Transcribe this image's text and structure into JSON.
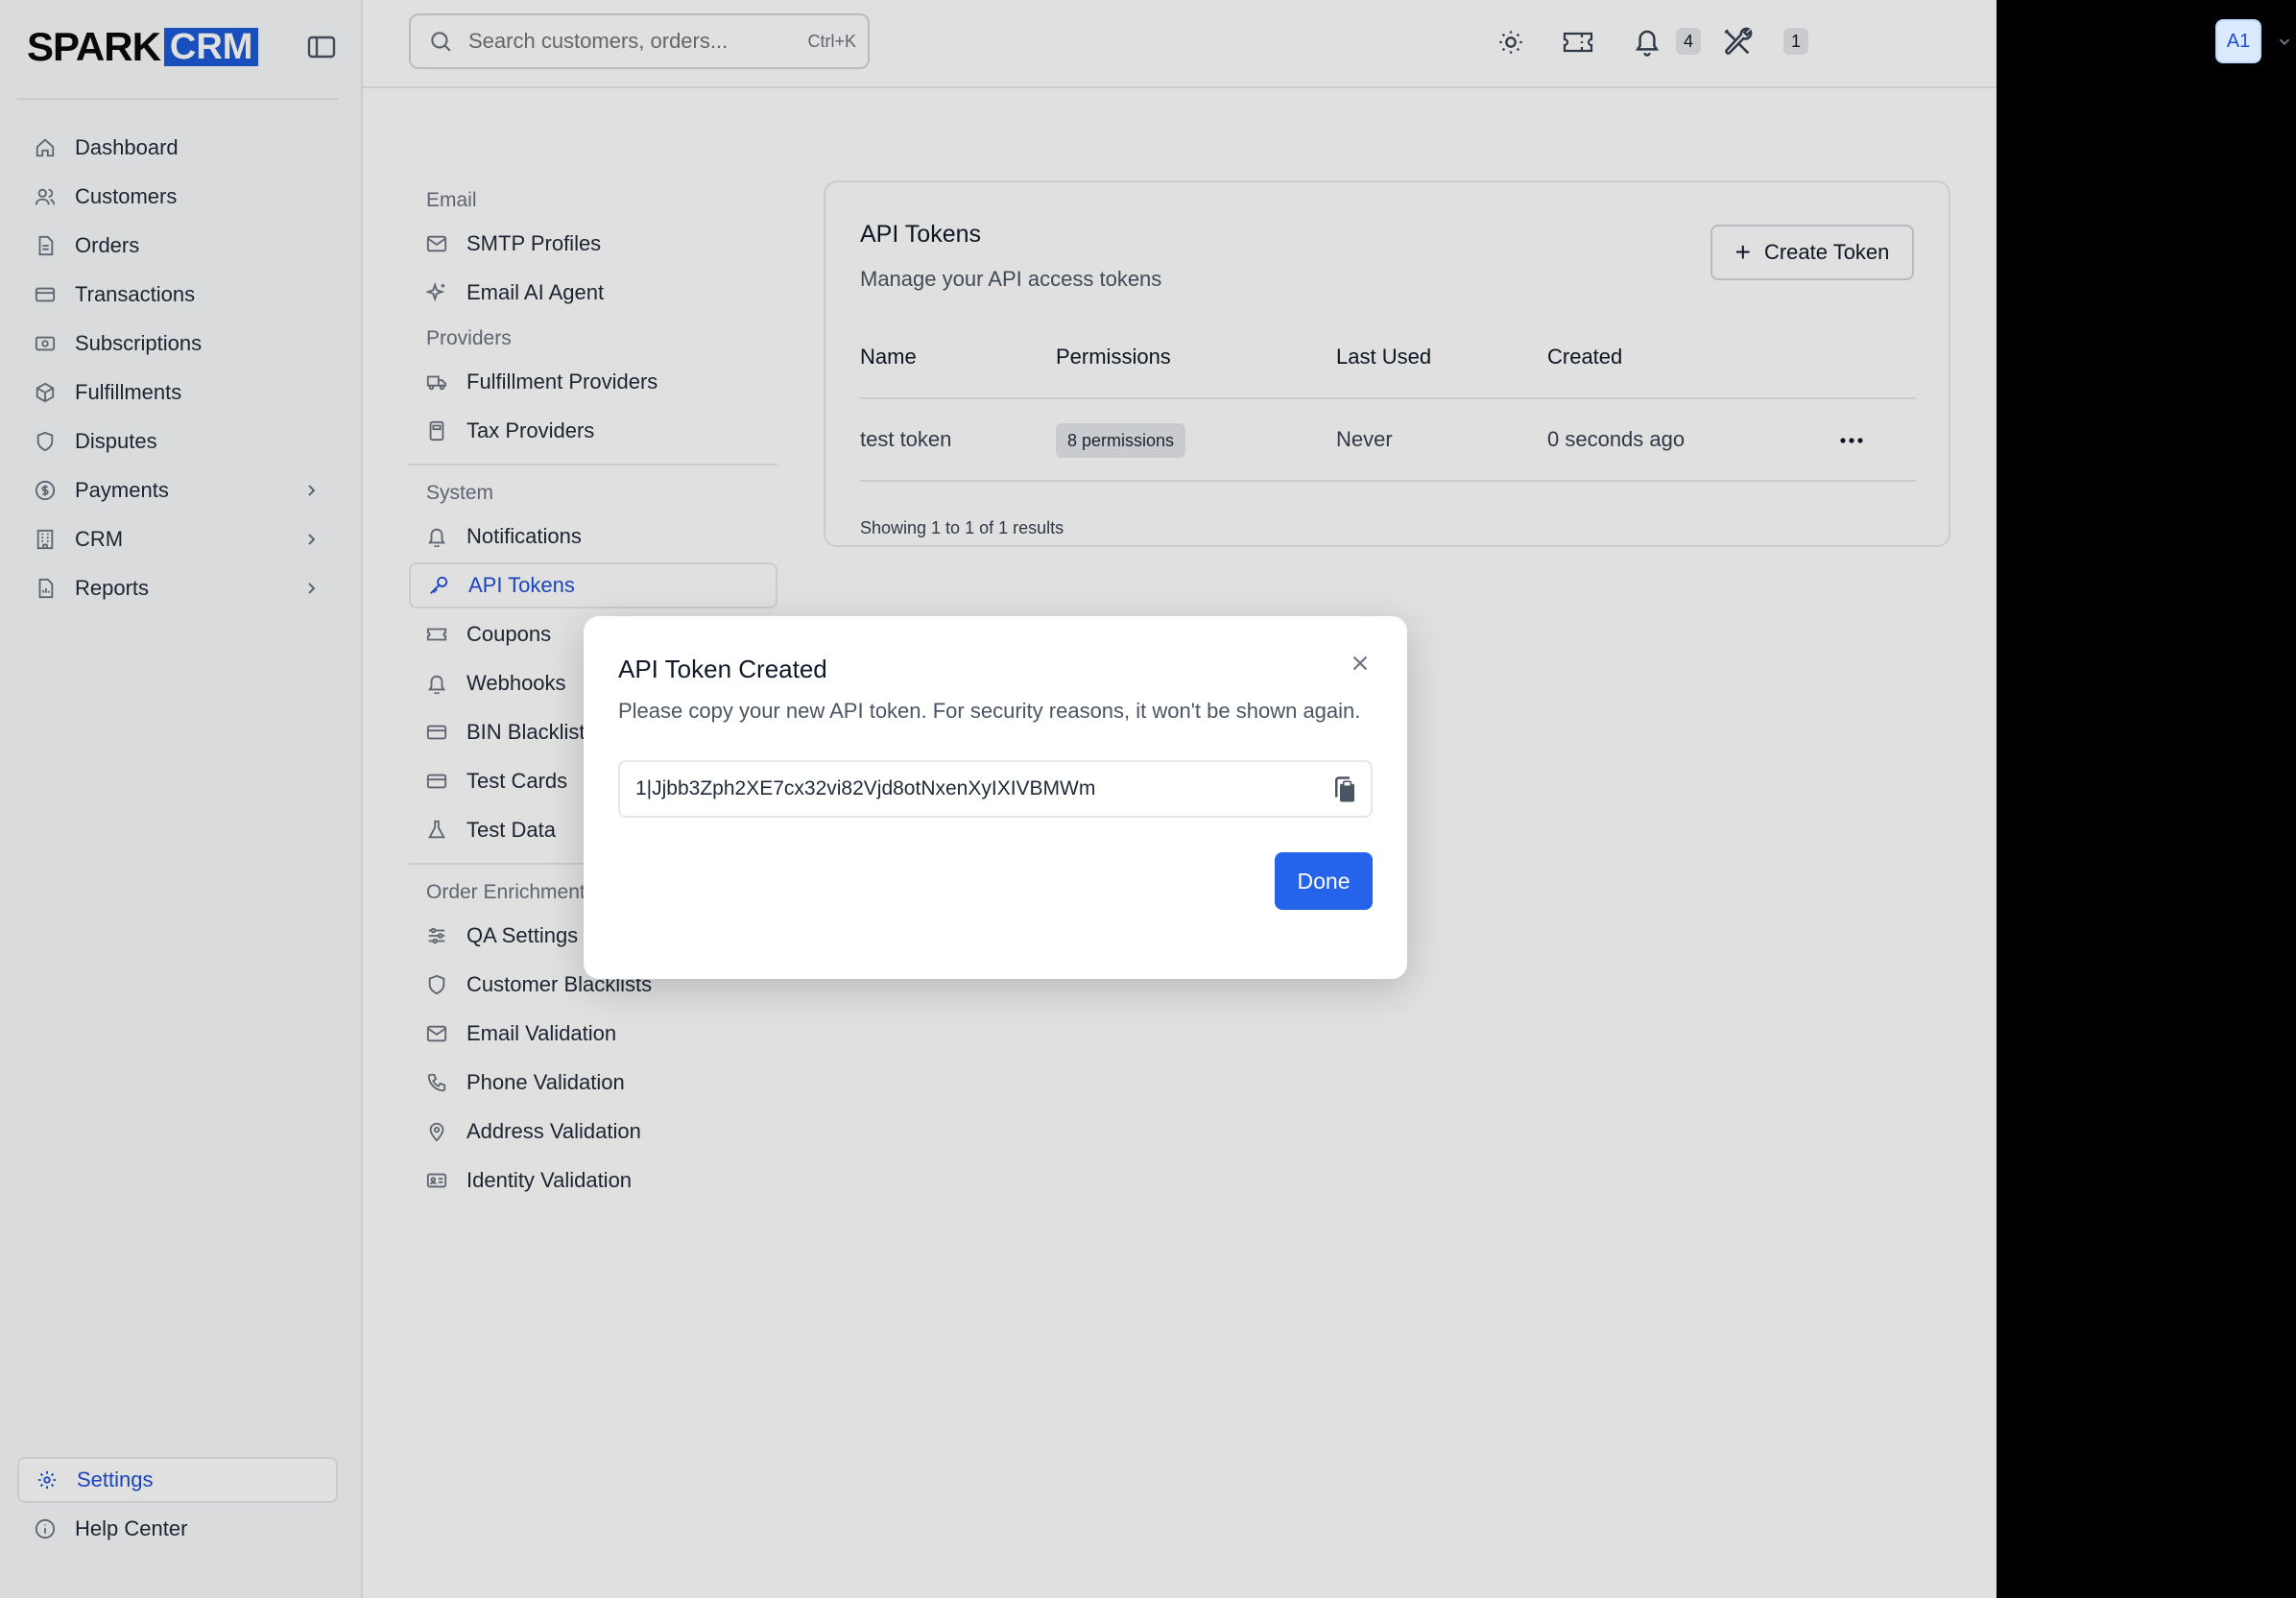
{
  "brand": {
    "part1": "SPARK",
    "part2": "CRM",
    "accent": "#1d5bd8"
  },
  "sidebar": {
    "items": [
      {
        "label": "Dashboard",
        "icon": "home-icon"
      },
      {
        "label": "Customers",
        "icon": "users-icon"
      },
      {
        "label": "Orders",
        "icon": "document-icon"
      },
      {
        "label": "Transactions",
        "icon": "credit-card-icon"
      },
      {
        "label": "Subscriptions",
        "icon": "cash-icon"
      },
      {
        "label": "Fulfillments",
        "icon": "package-icon"
      },
      {
        "label": "Disputes",
        "icon": "shield-icon"
      },
      {
        "label": "Payments",
        "icon": "dollar-circle-icon",
        "expandable": true
      },
      {
        "label": "CRM",
        "icon": "building-icon",
        "expandable": true
      },
      {
        "label": "Reports",
        "icon": "report-icon",
        "expandable": true
      }
    ],
    "bottom": [
      {
        "label": "Settings",
        "icon": "gear-icon",
        "active": true
      },
      {
        "label": "Help Center",
        "icon": "info-icon"
      }
    ]
  },
  "header": {
    "search_placeholder": "Search customers, orders...",
    "search_shortcut": "Ctrl+K",
    "notifications_count": "4",
    "tools_count": "1",
    "avatar_initials": "A1"
  },
  "settings_menu": {
    "sections": [
      {
        "heading": "Email",
        "items": [
          "SMTP Profiles",
          "Email AI Agent"
        ]
      },
      {
        "heading": "Providers",
        "items": [
          "Fulfillment Providers",
          "Tax Providers"
        ]
      },
      {
        "heading": "System",
        "items": [
          "Notifications",
          "API Tokens",
          "Coupons",
          "Webhooks",
          "BIN Blacklist",
          "Test Cards",
          "Test Data"
        ]
      },
      {
        "heading": "Order Enrichment",
        "items": [
          "QA Settings",
          "Customer Blacklists",
          "Email Validation",
          "Phone Validation",
          "Address Validation",
          "Identity Validation"
        ]
      }
    ],
    "active": "API Tokens"
  },
  "card": {
    "title": "API Tokens",
    "subtitle": "Manage your API access tokens",
    "create_button": "Create Token",
    "columns": [
      "Name",
      "Permissions",
      "Last Used",
      "Created"
    ],
    "rows": [
      {
        "name": "test token",
        "permissions": "8 permissions",
        "last_used": "Never",
        "created": "0 seconds ago"
      }
    ],
    "footer": "Showing 1 to 1 of 1 results"
  },
  "modal": {
    "title": "API Token Created",
    "text": "Please copy your new API token. For security reasons, it won't be shown again.",
    "token": "1|Jjbb3Zph2XE7cx32vi82Vjd8otNxenXyIXIVBMWm",
    "done_label": "Done"
  }
}
